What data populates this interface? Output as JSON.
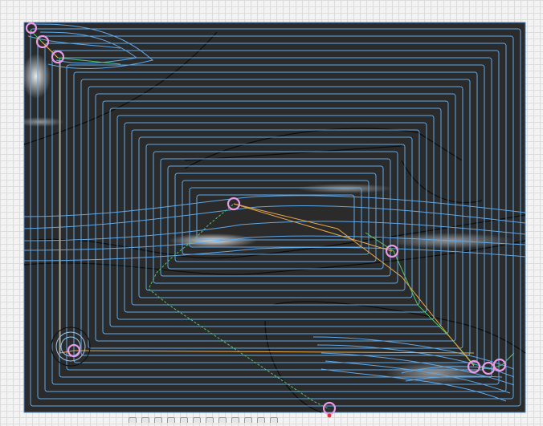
{
  "scene": {
    "background_color": "#f3f3f3",
    "stock_color": "#2b2b2b",
    "toolpath_color": "#5fa8e8",
    "rapid_color": "#e8a94a",
    "lead_color": "#52c46a",
    "contour_color": "#0d0d0d",
    "marker_color": "#e79be6",
    "selected_marker_color": "#e03030"
  },
  "toolbar": {
    "icons": [
      "view-front-icon",
      "view-top-icon",
      "orbit-icon",
      "pan-icon",
      "zoom-icon",
      "fit-icon",
      "display-mode-icon",
      "grid-toggle-icon",
      "layout-icon",
      "camera-icon",
      "settings-icon",
      "help-icon"
    ]
  }
}
